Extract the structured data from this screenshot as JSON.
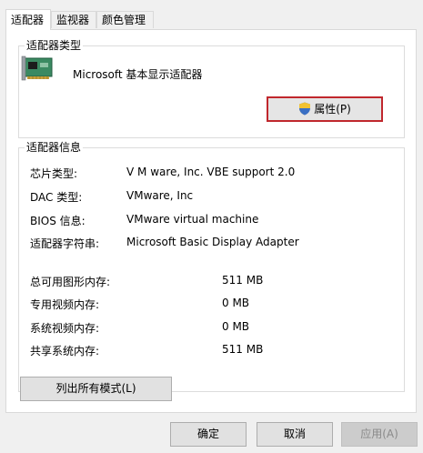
{
  "tabs": [
    {
      "label": "适配器"
    },
    {
      "label": "监视器"
    },
    {
      "label": "颜色管理"
    }
  ],
  "adapter_type": {
    "title": "适配器类型",
    "name": "Microsoft 基本显示适配器",
    "properties_button": "属性(P)"
  },
  "adapter_info": {
    "title": "适配器信息",
    "rows": [
      {
        "label": "芯片类型:",
        "value": "V M ware, Inc. VBE support 2.0"
      },
      {
        "label": "DAC 类型:",
        "value": "VMware, Inc"
      },
      {
        "label": "BIOS 信息:",
        "value": "VMware virtual machine"
      },
      {
        "label": "适配器字符串:",
        "value": "Microsoft Basic Display Adapter"
      }
    ],
    "memory": [
      {
        "label": "总可用图形内存:",
        "value": "511 MB"
      },
      {
        "label": "专用视频内存:",
        "value": "0 MB"
      },
      {
        "label": "系统视频内存:",
        "value": "0 MB"
      },
      {
        "label": "共享系统内存:",
        "value": "511 MB"
      }
    ]
  },
  "list_modes_button": "列出所有模式(L)",
  "footer": {
    "ok": "确定",
    "cancel": "取消",
    "apply": "应用(A)"
  },
  "icons": {
    "adapter": "graphics-card-icon",
    "properties": "uac-shield-icon"
  }
}
